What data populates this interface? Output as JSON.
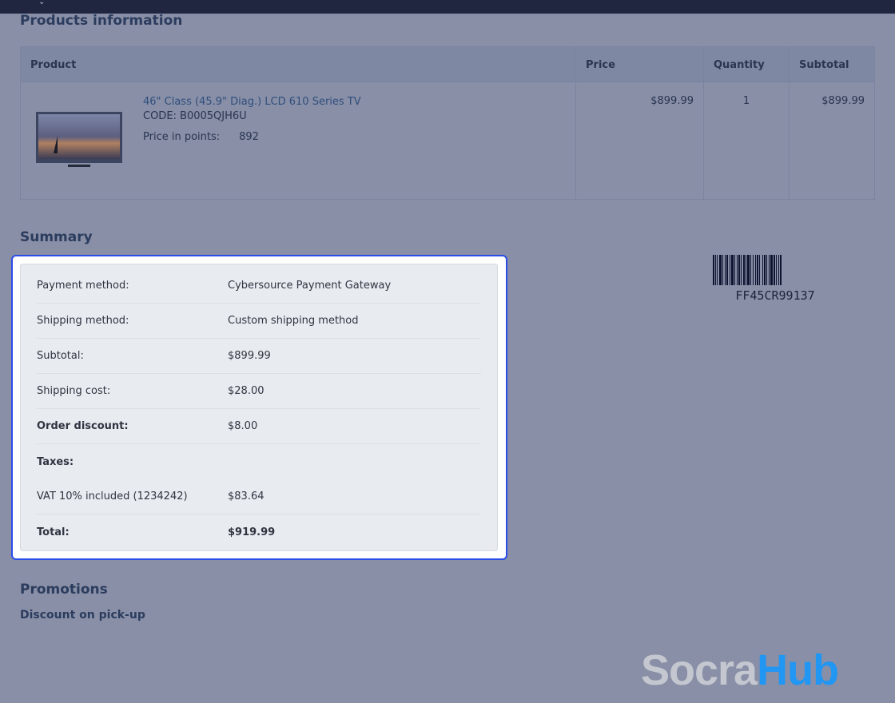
{
  "headings": {
    "products": "Products information",
    "summary": "Summary",
    "promotions": "Promotions",
    "promotion_name": "Discount on pick-up"
  },
  "table": {
    "columns": [
      "Product",
      "Price",
      "Quantity",
      "Subtotal"
    ],
    "rows": [
      {
        "name": "46\" Class (45.9\" Diag.) LCD 610 Series TV",
        "code": "CODE: B0005QJH6U",
        "points_label": "Price in points:",
        "points": "892",
        "price": "$899.99",
        "quantity": "1",
        "subtotal": "$899.99"
      }
    ]
  },
  "summary": [
    {
      "label": "Payment method:",
      "value": "Cybersource Payment Gateway"
    },
    {
      "label": "Shipping method:",
      "value": "Custom shipping method"
    },
    {
      "label": "Subtotal:",
      "value": "$899.99"
    },
    {
      "label": "Shipping cost:",
      "value": "$28.00"
    },
    {
      "label": "Order discount:",
      "value": "$8.00"
    },
    {
      "label": "Taxes:",
      "value": ""
    },
    {
      "label": "VAT 10% included (1234242)",
      "value": "$83.64"
    },
    {
      "label": "Total:",
      "value": "$919.99"
    }
  ],
  "barcode": "FF45CR99137",
  "logo": {
    "part1": "Socra",
    "part2": "Hub"
  },
  "colors": {
    "highlight": "#2a4de8",
    "logo_blue": "#2196f3"
  }
}
